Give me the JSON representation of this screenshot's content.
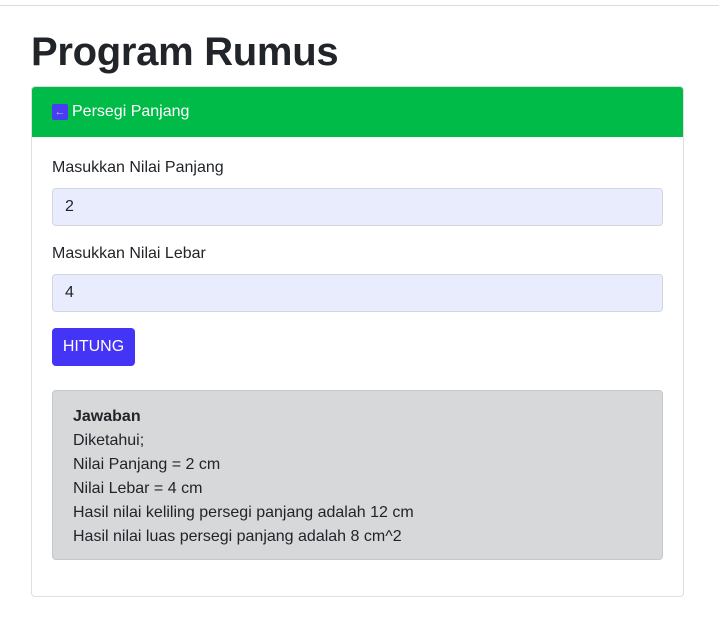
{
  "page": {
    "title": "Program Rumus"
  },
  "card": {
    "back_icon": "arrow-left-icon",
    "header_title": "Persegi Panjang",
    "header_color": "#00bb48"
  },
  "form": {
    "panjang_label": "Masukkan Nilai Panjang",
    "panjang_value": "2",
    "lebar_label": "Masukkan Nilai Lebar",
    "lebar_value": "4",
    "submit_label": "HITUNG",
    "submit_color": "#4434f5"
  },
  "result": {
    "title": "Jawaban",
    "lines": [
      "Diketahui;",
      "Nilai Panjang = 2 cm",
      "Nilai Lebar = 4 cm",
      "Hasil nilai keliling persegi panjang adalah 12 cm",
      "Hasil nilai luas persegi panjang adalah 8 cm^2"
    ]
  }
}
